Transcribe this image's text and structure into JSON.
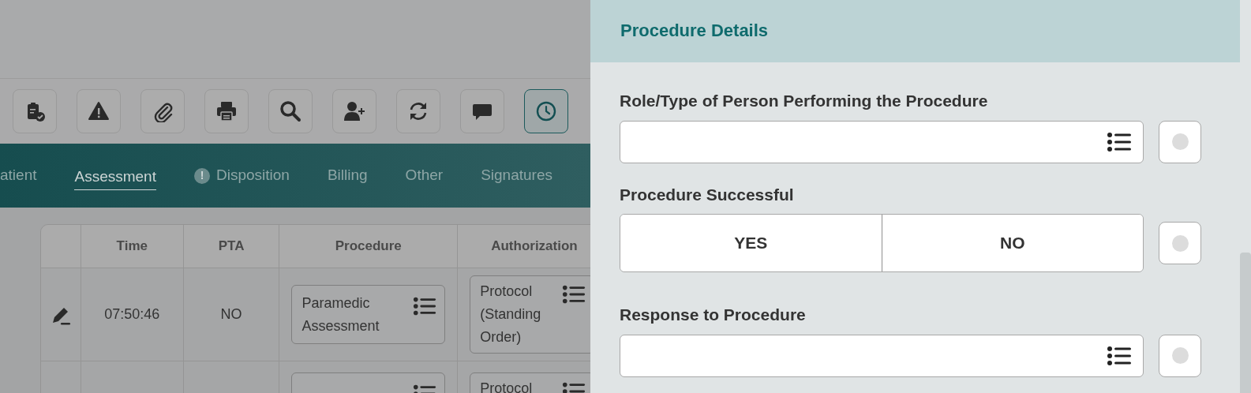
{
  "toolbar": [
    {
      "selected": false
    },
    {
      "selected": false
    },
    {
      "selected": false
    },
    {
      "selected": false
    },
    {
      "selected": false
    },
    {
      "selected": false
    },
    {
      "selected": false
    },
    {
      "selected": false
    },
    {
      "selected": true
    }
  ],
  "tabs": [
    {
      "label": "atient",
      "selected": false,
      "alert": false
    },
    {
      "label": "Assessment",
      "selected": true,
      "alert": false
    },
    {
      "label": "Disposition",
      "selected": false,
      "alert": true,
      "alert_text": "!"
    },
    {
      "label": "Billing",
      "selected": false,
      "alert": false
    },
    {
      "label": "Other",
      "selected": false,
      "alert": false
    },
    {
      "label": "Signatures",
      "selected": false,
      "alert": false
    }
  ],
  "table": {
    "columns": [
      "Time",
      "PTA",
      "Procedure",
      "Authorization"
    ],
    "rows": [
      {
        "time": "07:50:46",
        "pta": "NO",
        "procedure": "Paramedic Assessment",
        "authorization": "Protocol (Standing Order)"
      },
      {
        "time": "",
        "pta": "",
        "procedure": "",
        "authorization": "Protocol"
      }
    ]
  },
  "panel": {
    "title": "Procedure Details",
    "fields": [
      {
        "kind": "select",
        "label": "Role/Type of Person Performing the Procedure"
      },
      {
        "kind": "toggle",
        "label": "Procedure Successful",
        "options": [
          {
            "label": "YES",
            "selected": false
          },
          {
            "label": "NO",
            "selected": false
          }
        ]
      },
      {
        "kind": "select",
        "label": "Response to Procedure"
      }
    ]
  }
}
